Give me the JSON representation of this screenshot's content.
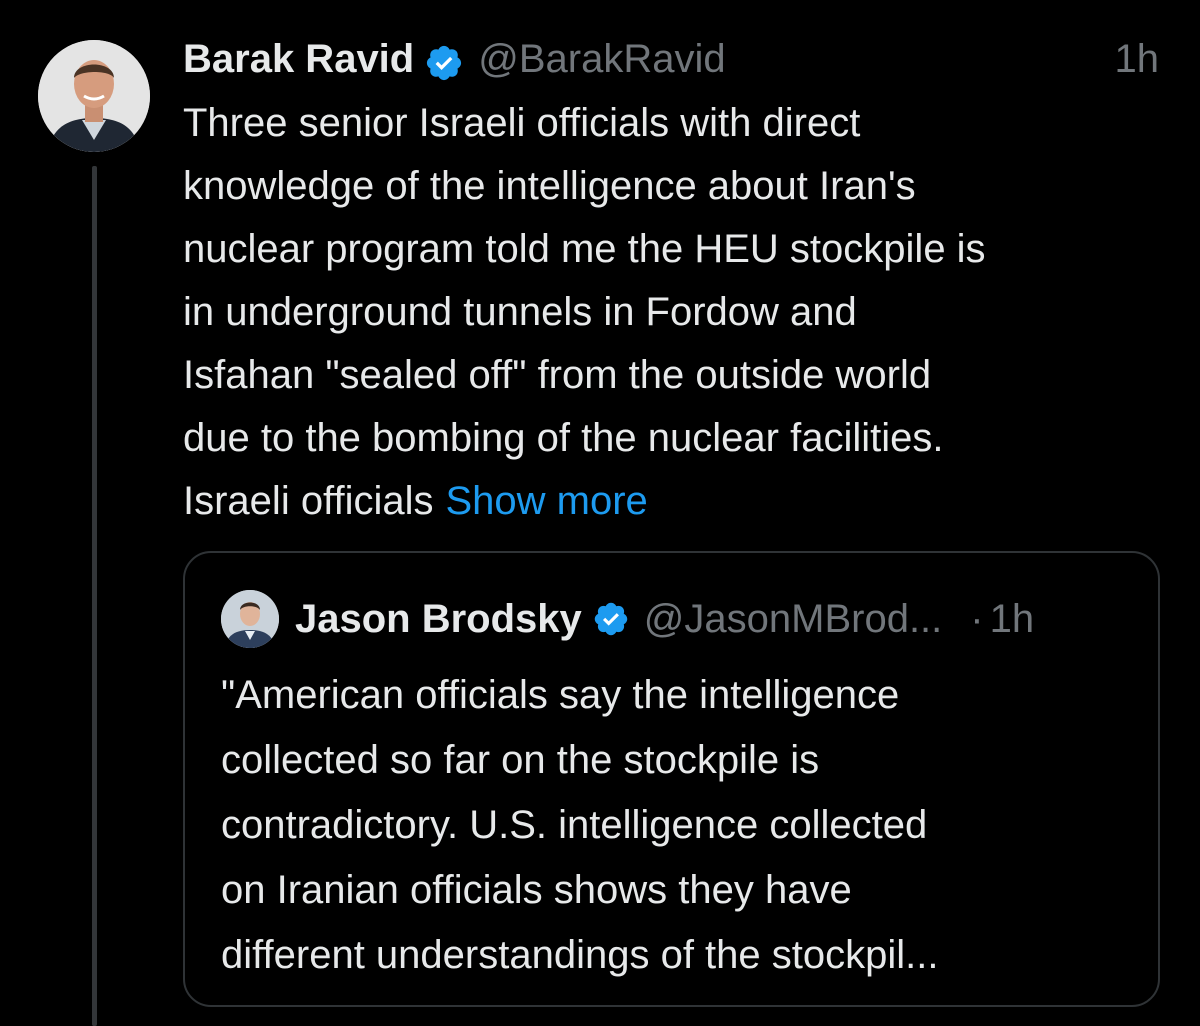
{
  "tweet": {
    "display_name": "Barak Ravid",
    "handle": "@BarakRavid",
    "time": "1h",
    "body_lines": [
      "Three senior Israeli officials with direct",
      "knowledge of the intelligence about Iran's",
      "nuclear program told me the HEU stockpile is",
      "in underground tunnels in Fordow and",
      "Isfahan \"sealed off\" from the outside world",
      "due to the bombing of the nuclear facilities.",
      "Israeli officials"
    ],
    "show_more": "Show more",
    "avatar_icon": "profile-photo",
    "verified_icon": "verified-badge-icon"
  },
  "quote": {
    "display_name": "Jason Brodsky",
    "handle": "@JasonMBrod...",
    "separator": "·",
    "time": "1h",
    "body_lines": [
      "\"American officials say the intelligence",
      "collected so far on the stockpile is",
      "contradictory. U.S. intelligence collected",
      "on Iranian officials shows they have",
      "different understandings of the stockpil..."
    ],
    "avatar_icon": "profile-photo",
    "verified_icon": "verified-badge-icon"
  },
  "colors": {
    "background": "#000000",
    "text": "#e7e9ea",
    "muted": "#71767b",
    "link": "#1d9bf0",
    "border": "#2f3336",
    "thread_line": "#333639"
  }
}
